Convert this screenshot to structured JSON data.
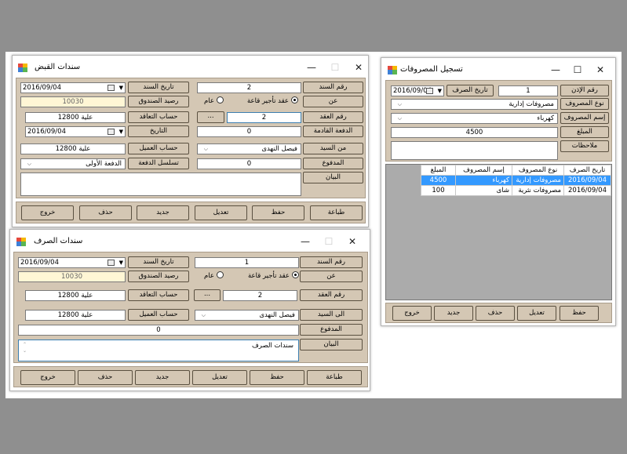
{
  "receipts": {
    "title": "سندات القبض",
    "doc_no_label": "رقم السند",
    "doc_no": "2",
    "doc_date_label": "تاريخ السند",
    "doc_date": "2016/09/04",
    "about_label": "عن",
    "radio_hall": "عقد تأجير قاعة",
    "radio_general": "عام",
    "box_balance_label": "رصيد الصندوق",
    "box_balance": "10030",
    "contract_no_label": "رقم العقد",
    "contract_no": "2",
    "browse": "...",
    "contract_account_label": "حساب التعاقد",
    "contract_account": "علية 12800",
    "next_payment_label": "الدفعة القادمة",
    "next_payment": "0",
    "date_label": "التاريخ",
    "date": "2016/09/04",
    "from_label": "من السيد",
    "from_value": "فيصل النهدى",
    "customer_account_label": "حساب العميل",
    "customer_account": "علية 12800",
    "paid_label": "المدفوع",
    "paid": "0",
    "payment_seq_label": "تسلسل الدفعة",
    "payment_seq": "الدفعة الأولى",
    "statement_label": "البيان",
    "statement": "",
    "buttons": {
      "print": "طباعة",
      "save": "حفظ",
      "edit": "تعديل",
      "new": "جديد",
      "delete": "حذف",
      "exit": "خروج"
    }
  },
  "payments": {
    "title": "سندات الصرف",
    "doc_no_label": "رقم السند",
    "doc_no": "1",
    "doc_date_label": "تاريخ السند",
    "doc_date": "2016/09/04",
    "about_label": "عن",
    "radio_hall": "عقد تأجير قاعة",
    "radio_general": "عام",
    "box_balance_label": "رصيد الصندوق",
    "box_balance": "10030",
    "contract_no_label": "رقم العقد",
    "contract_no": "2",
    "browse": "...",
    "contract_account_label": "حساب التعاقد",
    "contract_account": "علية 12800",
    "to_label": "الى السيد",
    "to_value": "فيصل النهدى",
    "customer_account_label": "حساب العميل",
    "customer_account": "علية 12800",
    "paid_label": "المدفوع",
    "paid": "0",
    "statement_label": "البيان",
    "statement": "سندات الصرف",
    "buttons": {
      "print": "طباعة",
      "save": "حفظ",
      "edit": "تعديل",
      "new": "جديد",
      "delete": "حذف",
      "exit": "خروج"
    }
  },
  "expenses": {
    "title": "تسجيل المصروفات",
    "permit_no_label": "رقم الإذن",
    "permit_no": "1",
    "spend_date_label": "تاريخ الصرف",
    "spend_date": "2016/09/04",
    "expense_type_label": "نوع المصروف",
    "expense_type": "مصروفات إدارية",
    "expense_name_label": "إسم المصروف",
    "expense_name": "كهرباء",
    "amount_label": "المبلغ",
    "amount": "4500",
    "notes_label": "ملاحظات",
    "notes": "",
    "grid": {
      "headers": [
        "تاريخ الصرف",
        "نوع المصروف",
        "إسم المصروف",
        "المبلغ"
      ],
      "rows": [
        [
          "2016/09/04",
          "مصروفات إدارية",
          "كهرباء",
          "4500"
        ],
        [
          "2016/09/04",
          "مصروفات نثرية",
          "شاى",
          "100"
        ]
      ]
    },
    "buttons": {
      "save": "حفظ",
      "edit": "تعديل",
      "delete": "حذف",
      "new": "جديد",
      "exit": "خروج"
    }
  }
}
